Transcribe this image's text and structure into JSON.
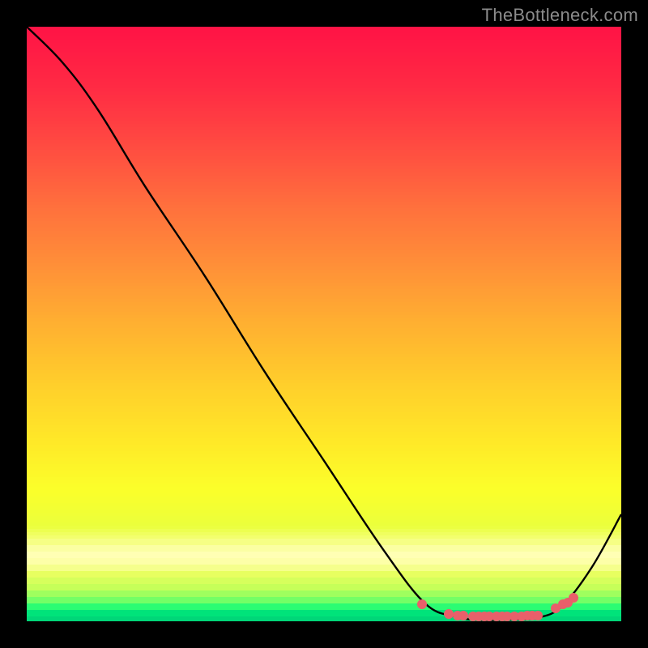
{
  "watermark": "TheBottleneck.com",
  "colors": {
    "dot": "#e95f6a",
    "curve": "#000000"
  },
  "chart_data": {
    "type": "line",
    "title": "",
    "xlabel": "",
    "ylabel": "",
    "xlim": [
      0,
      100
    ],
    "ylim": [
      0,
      100
    ],
    "grid": false,
    "legend": false,
    "series": [
      {
        "name": "curve",
        "x": [
          0,
          6,
          12,
          20,
          30,
          40,
          50,
          60,
          67,
          72,
          75,
          78,
          82,
          86,
          90,
          95,
          100
        ],
        "y": [
          100,
          94,
          86,
          73,
          58,
          42,
          27,
          12,
          3,
          0.8,
          0.3,
          0.2,
          0.3,
          0.6,
          2.5,
          9,
          18
        ]
      }
    ],
    "markers": {
      "name": "flat-region",
      "x": [
        66.5,
        71,
        72.5,
        73.5,
        75,
        76,
        77,
        77.8,
        79,
        80,
        80.8,
        82,
        83.2,
        84.2,
        85,
        86,
        89,
        90.2,
        91,
        92
      ],
      "y": [
        2.8,
        1.2,
        1.0,
        0.9,
        0.8,
        0.8,
        0.8,
        0.8,
        0.8,
        0.8,
        0.8,
        0.8,
        0.8,
        0.9,
        0.9,
        1.0,
        2.2,
        2.8,
        3.2,
        4.0
      ]
    },
    "background_gradient_stops": [
      {
        "pos": 0.0,
        "color": "#ff1345"
      },
      {
        "pos": 0.1,
        "color": "#ff2a44"
      },
      {
        "pos": 0.2,
        "color": "#ff4b41"
      },
      {
        "pos": 0.3,
        "color": "#ff6f3d"
      },
      {
        "pos": 0.4,
        "color": "#ff8f38"
      },
      {
        "pos": 0.5,
        "color": "#ffb031"
      },
      {
        "pos": 0.6,
        "color": "#ffce2b"
      },
      {
        "pos": 0.7,
        "color": "#ffe928"
      },
      {
        "pos": 0.78,
        "color": "#fbff2a"
      },
      {
        "pos": 0.84,
        "color": "#eaff3c"
      },
      {
        "pos": 0.885,
        "color": "#ffffb8"
      },
      {
        "pos": 0.905,
        "color": "#fcffa2"
      },
      {
        "pos": 0.92,
        "color": "#e8ff60"
      },
      {
        "pos": 0.945,
        "color": "#c3ff58"
      },
      {
        "pos": 0.965,
        "color": "#71ff66"
      },
      {
        "pos": 0.975,
        "color": "#2dfd73"
      },
      {
        "pos": 0.985,
        "color": "#00e57a"
      },
      {
        "pos": 1.0,
        "color": "#00d378"
      }
    ]
  }
}
